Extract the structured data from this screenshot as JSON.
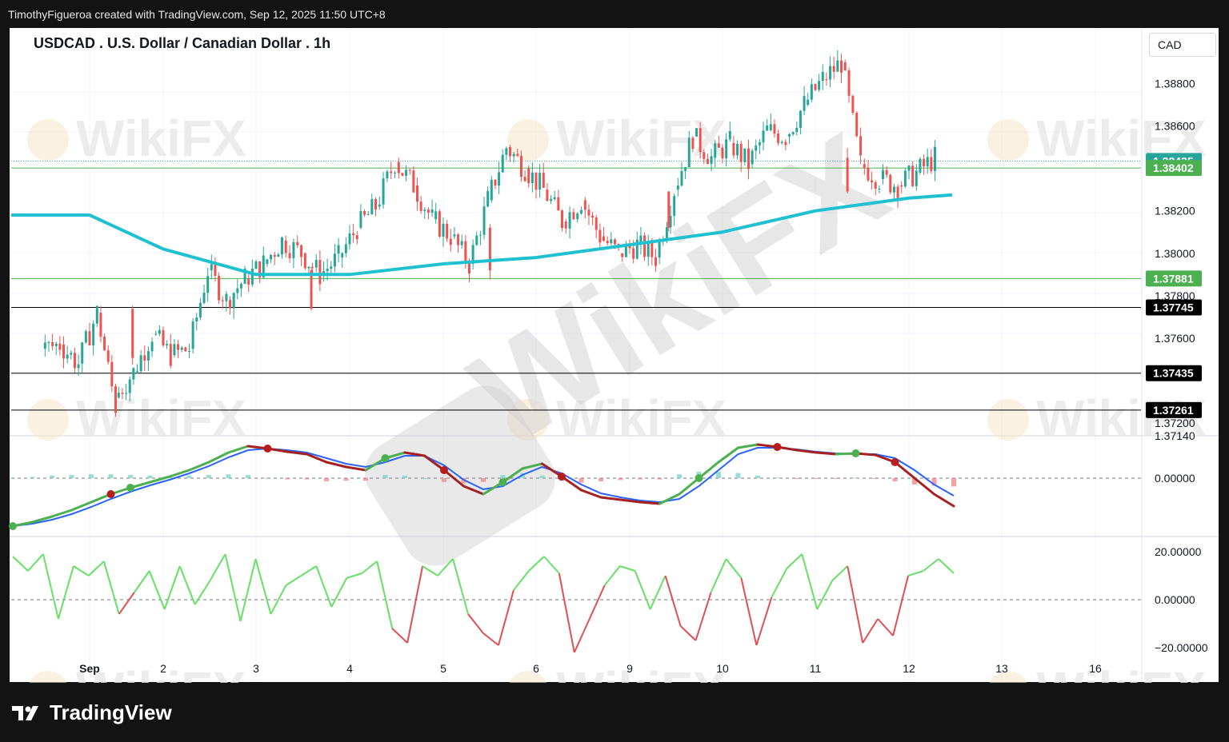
{
  "header": {
    "credit": "TimothyFigueroa created with TradingView.com, Sep 12, 2025 11:50 UTC+8"
  },
  "chart": {
    "title": "USDCAD . U.S. Dollar / Canadian Dollar . 1h",
    "currency": "CAD"
  },
  "footer": {
    "brand": "TradingView"
  },
  "watermark": "WikiFX",
  "colors": {
    "up": "#26a69a",
    "down": "#ef5350",
    "ema": "#1fc1d0",
    "support_line": "#4caf50",
    "macd_fast": "#4caf50",
    "macd_fast_down": "#a52020",
    "macd_signal": "#2962ff",
    "osc_up": "#66e066",
    "osc_down": "#e05050",
    "badge_green": "#4caf50",
    "badge_black": "#000000"
  },
  "chart_data": [
    {
      "type": "candlestick",
      "title": "USDCAD . U.S. Dollar / Canadian Dollar . 1h",
      "timeframe": "1h",
      "x_tick_labels": [
        "Sep",
        "2",
        "3",
        "4",
        "5",
        "6",
        "9",
        "10",
        "11",
        "12",
        "13",
        "16"
      ],
      "price_axis_labels": [
        "1.38800",
        "1.38600",
        "1.38200",
        "1.38000",
        "1.37800",
        "1.37600",
        "1.37200",
        "1.37140"
      ],
      "ylim": [
        1.3714,
        1.3896
      ],
      "price_path": [
        [
          "Sep",
          1.3755
        ],
        [
          "Sep",
          1.3757
        ],
        [
          "Sep",
          1.3748
        ],
        [
          "Sep",
          1.3772
        ],
        [
          "Sep",
          1.3728
        ],
        [
          "2",
          1.3732
        ],
        [
          "2",
          1.3744
        ],
        [
          "2",
          1.3762
        ],
        [
          "2",
          1.3752
        ],
        [
          "2",
          1.3755
        ],
        [
          "3",
          1.3792
        ],
        [
          "3",
          1.3778
        ],
        [
          "3",
          1.3788
        ],
        [
          "3",
          1.3795
        ],
        [
          "3",
          1.3806
        ],
        [
          "4",
          1.38
        ],
        [
          "4",
          1.379
        ],
        [
          "4",
          1.3798
        ],
        [
          "4",
          1.3812
        ],
        [
          "4",
          1.3822
        ],
        [
          "5",
          1.3843
        ],
        [
          "5",
          1.3832
        ],
        [
          "5",
          1.3816
        ],
        [
          "5",
          1.3808
        ],
        [
          "5",
          1.3795
        ],
        [
          "6",
          1.3825
        ],
        [
          "6",
          1.385
        ],
        [
          "6",
          1.384
        ],
        [
          "6",
          1.383
        ],
        [
          "6",
          1.3815
        ],
        [
          "9",
          1.3825
        ],
        [
          "9",
          1.3808
        ],
        [
          "9",
          1.38
        ],
        [
          "9",
          1.3804
        ],
        [
          "9",
          1.3798
        ],
        [
          "10",
          1.383
        ],
        [
          "10",
          1.3855
        ],
        [
          "10",
          1.3845
        ],
        [
          "10",
          1.3852
        ],
        [
          "10",
          1.3842
        ],
        [
          "11",
          1.3858
        ],
        [
          "11",
          1.3855
        ],
        [
          "11",
          1.387
        ],
        [
          "11",
          1.3882
        ],
        [
          "11",
          1.389
        ],
        [
          "12",
          1.3842
        ],
        [
          "12",
          1.3835
        ],
        [
          "12",
          1.3832
        ],
        [
          "12",
          1.3838
        ],
        [
          "12",
          1.3845
        ]
      ],
      "ema_path": [
        [
          "Sep",
          1.3818
        ],
        [
          "2",
          1.3802
        ],
        [
          "3",
          1.379
        ],
        [
          "4",
          1.379
        ],
        [
          "5",
          1.3795
        ],
        [
          "6",
          1.3798
        ],
        [
          "9",
          1.3804
        ],
        [
          "10",
          1.381
        ],
        [
          "11",
          1.382
        ],
        [
          "12",
          1.3826
        ]
      ],
      "levels": [
        {
          "price": 1.38435,
          "label": "1.38435",
          "style": "dotted"
        },
        {
          "price": 1.38402,
          "label": "1.38402",
          "style": "green"
        },
        {
          "price": 1.37881,
          "label": "1.37881",
          "style": "green"
        },
        {
          "price": 1.37745,
          "label": "1.37745",
          "style": "black"
        },
        {
          "price": 1.37435,
          "label": "1.37435",
          "style": "black"
        },
        {
          "price": 1.37261,
          "label": "1.37261",
          "style": "black"
        }
      ]
    },
    {
      "type": "line",
      "panel": "macd",
      "axis_labels": [
        "0.00000"
      ],
      "fast": [
        0.0,
        0.05,
        0.12,
        0.2,
        0.3,
        0.4,
        0.48,
        0.55,
        0.62,
        0.7,
        0.8,
        0.92,
        1.0,
        0.97,
        0.93,
        0.9,
        0.8,
        0.74,
        0.7,
        0.85,
        0.92,
        0.88,
        0.7,
        0.5,
        0.4,
        0.55,
        0.72,
        0.78,
        0.62,
        0.45,
        0.36,
        0.33,
        0.3,
        0.28,
        0.4,
        0.6,
        0.8,
        0.98,
        1.02,
        0.99,
        0.95,
        0.92,
        0.9,
        0.91,
        0.89,
        0.8,
        0.6,
        0.4,
        0.25
      ],
      "signal": [
        0.0,
        0.03,
        0.08,
        0.15,
        0.24,
        0.34,
        0.43,
        0.51,
        0.58,
        0.66,
        0.75,
        0.86,
        0.95,
        0.97,
        0.95,
        0.92,
        0.85,
        0.78,
        0.74,
        0.8,
        0.88,
        0.88,
        0.76,
        0.58,
        0.46,
        0.5,
        0.64,
        0.74,
        0.66,
        0.52,
        0.41,
        0.36,
        0.32,
        0.3,
        0.34,
        0.5,
        0.7,
        0.9,
        0.98,
        0.98,
        0.96,
        0.93,
        0.91,
        0.9,
        0.9,
        0.85,
        0.7,
        0.52,
        0.38
      ],
      "crossovers": [
        {
          "i": 0,
          "kind": "up"
        },
        {
          "i": 5,
          "kind": "down"
        },
        {
          "i": 6,
          "kind": "up"
        },
        {
          "i": 13,
          "kind": "down"
        },
        {
          "i": 19,
          "kind": "up"
        },
        {
          "i": 22,
          "kind": "down"
        },
        {
          "i": 25,
          "kind": "up"
        },
        {
          "i": 28,
          "kind": "down"
        },
        {
          "i": 35,
          "kind": "up"
        },
        {
          "i": 39,
          "kind": "down"
        },
        {
          "i": 43,
          "kind": "up"
        },
        {
          "i": 45,
          "kind": "down"
        }
      ]
    },
    {
      "type": "line",
      "panel": "oscillator",
      "axis_labels": [
        "20.00000",
        "0.00000",
        "−20.00000"
      ],
      "ylim": [
        -25,
        25
      ],
      "values": [
        18,
        12,
        19,
        -8,
        14,
        10,
        16,
        -6,
        3,
        12,
        -4,
        14,
        -2,
        8,
        19,
        -9,
        17,
        -6,
        6,
        10,
        14,
        -3,
        9,
        11,
        16,
        -12,
        -18,
        14,
        10,
        17,
        -6,
        -14,
        -19,
        4,
        12,
        18,
        11,
        -22,
        -8,
        6,
        14,
        12,
        -4,
        10,
        -11,
        -17,
        3,
        17,
        9,
        -19,
        1,
        13,
        19,
        -4,
        8,
        14,
        -18,
        -8,
        -15,
        10,
        12,
        17,
        11
      ]
    }
  ]
}
